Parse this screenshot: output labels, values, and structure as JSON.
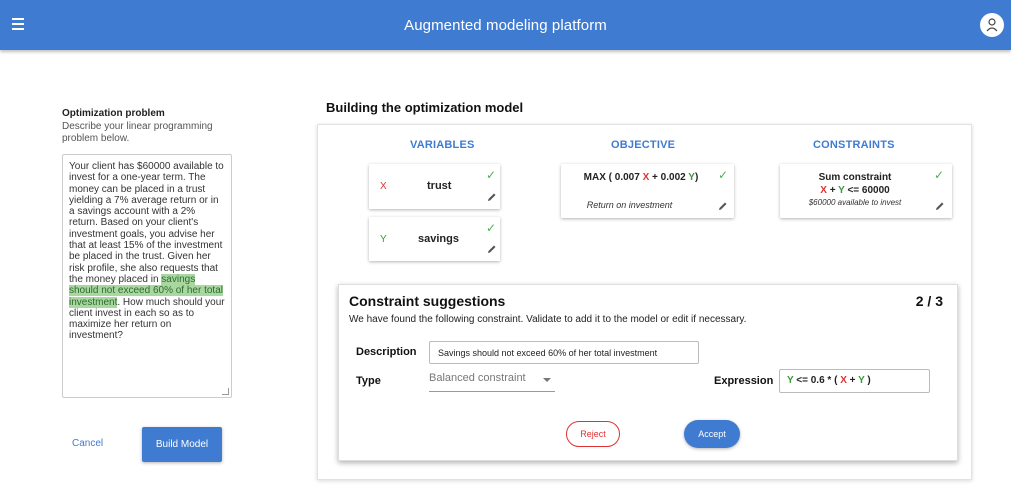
{
  "appbar": {
    "title": "Augmented modeling platform"
  },
  "left_panel": {
    "title": "Optimization problem",
    "subtitle": "Describe your linear programming problem below.",
    "problem_text_before": "Your client has $60000 available to invest for a one-year term. The money can be placed in a trust yielding a 7% average return or in a savings account with a 2% return. Based on your client's investment goals, you advise her that at least 15% of the investment be placed in the trust. Given her risk profile, she also requests that the money placed in ",
    "problem_text_highlight": "savings should not exceed 60% of her total investment",
    "problem_text_after": ". How much should your client invest in each so as to maximize her return on investment?",
    "cancel_label": "Cancel",
    "build_label": "Build Model"
  },
  "model": {
    "title": "Building the optimization model",
    "headers": {
      "variables": "VARIABLES",
      "objective": "OBJECTIVE",
      "constraints": "CONSTRAINTS"
    },
    "variables": [
      {
        "letter": "X",
        "name": "trust"
      },
      {
        "letter": "Y",
        "name": "savings"
      }
    ],
    "objective": {
      "prefix": "MAX ( 0.007 ",
      "var1": "X",
      "middle": " + 0.002 ",
      "var2": "Y",
      "suffix": ")",
      "description": "Return on investment"
    },
    "constraint": {
      "title": "Sum constraint",
      "var1": "X",
      "op": " + ",
      "var2": "Y",
      "rhs": " <= 60000",
      "description": "$60000 available to invest"
    },
    "check_glyph": "✓"
  },
  "suggestion": {
    "title": "Constraint suggestions",
    "count": "2 / 3",
    "intro": "We have found the following constraint. Validate to add it to the model or edit if necessary.",
    "description_label": "Description",
    "description_value": "Savings should not exceed 60% of her total investment",
    "type_label": "Type",
    "type_value": "Balanced constraint",
    "expression_label": "Expression",
    "expression": {
      "var_y": "Y",
      "mid": " <= 0.6 * ( ",
      "var_x": "X",
      "plus": " + ",
      "var_y2": "Y",
      "end": " )"
    },
    "reject_label": "Reject",
    "accept_label": "Accept"
  },
  "colors": {
    "primary": "#3f7bd1",
    "x_var": "#dd3333",
    "y_var": "#3a9a3a",
    "check": "#4caf50"
  }
}
